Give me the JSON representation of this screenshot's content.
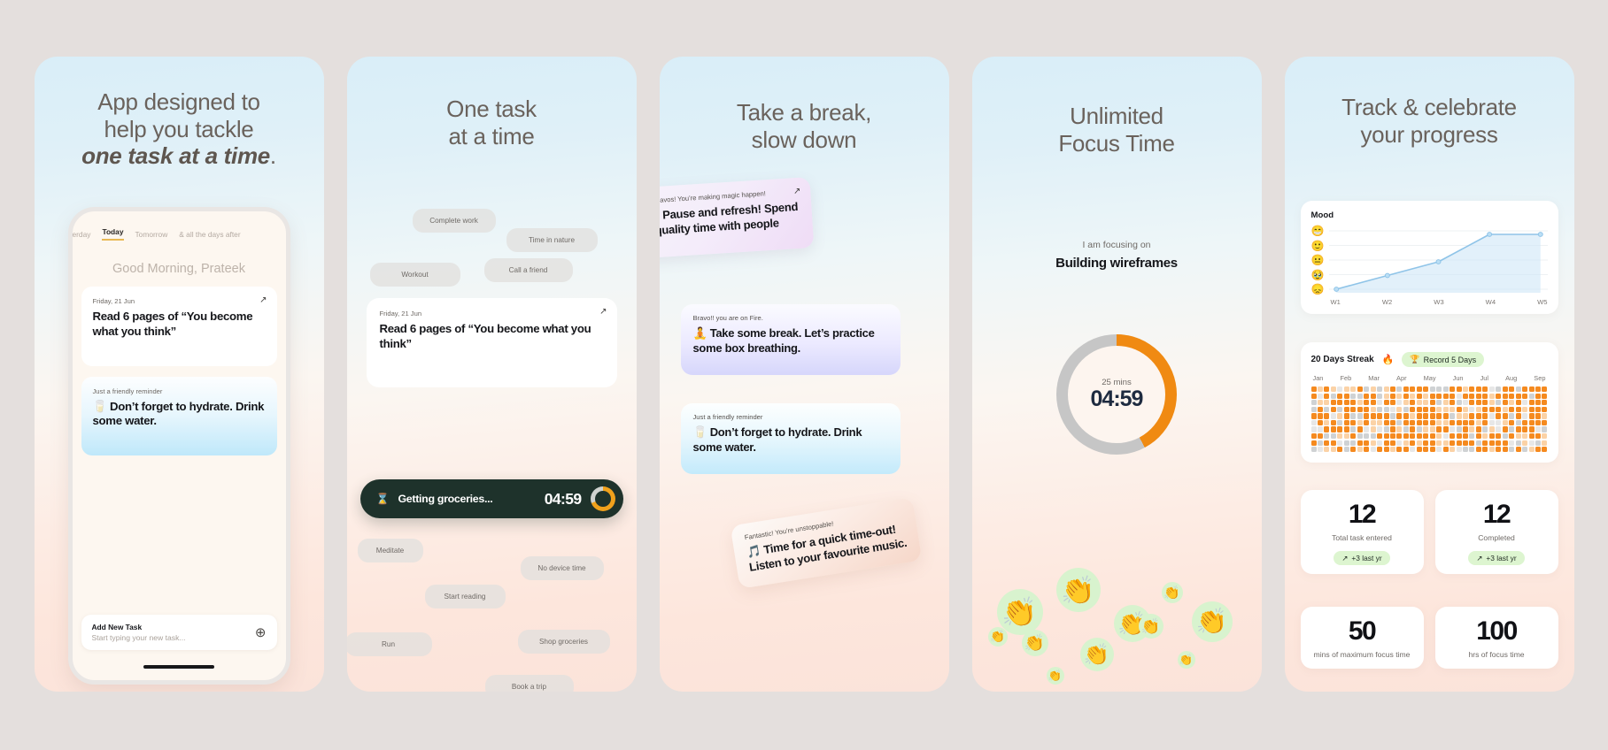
{
  "background_color": "#e4dfdd",
  "accent_orange": "#f08a12",
  "panels": [
    {
      "id": "panel-tasks",
      "headline_line1": "App designed to",
      "headline_line2": "help you tackle",
      "headline_emphasis": "one task at a time",
      "headline_period": ".",
      "phone": {
        "tabs": [
          {
            "label": "Yesterday",
            "active": false
          },
          {
            "label": "Today",
            "active": true
          },
          {
            "label": "Tomorrow",
            "active": false
          },
          {
            "label": "& all the days after",
            "active": false
          }
        ],
        "greeting": "Good Morning, Prateek",
        "cards": [
          {
            "meta": "Friday, 21 Jun",
            "title": "Read 6 pages of “You become what you think”",
            "expand_icon": "↗"
          },
          {
            "meta": "Just a friendly reminder",
            "title": "🥛 Don’t forget to hydrate. Drink some water."
          }
        ],
        "add_task": {
          "label": "Add New Task",
          "placeholder": "Start typing your new task...",
          "plus_icon": "⊕"
        }
      }
    },
    {
      "id": "panel-one-task",
      "headline_line1": "One task",
      "headline_line2": "at a time",
      "chips_top": [
        "Complete work",
        "Time in nature",
        "Workout",
        "Call a friend"
      ],
      "card": {
        "meta": "Friday, 21 Jun",
        "title": "Read 6 pages of “You become what you think”",
        "expand_icon": "↗"
      },
      "timer_pill": {
        "icon": "⌛",
        "label": "Getting groceries...",
        "time": "04:59"
      },
      "chips_bottom": [
        "Meditate",
        "No device time",
        "Start reading",
        "Run",
        "Shop groceries",
        "Book a trip"
      ]
    },
    {
      "id": "panel-break",
      "headline_line1": "Take a break,",
      "headline_line2": "slow down",
      "notes": [
        {
          "meta": "Bravos! You’re making magic happen!",
          "body": "⏸ Pause and refresh! Spend quality time with people",
          "expand_icon": "↗"
        },
        {
          "meta": "Bravo!! you are on Fire.",
          "body": "🧘 Take some break. Let’s practice some box breathing."
        },
        {
          "meta": "Just a friendly reminder",
          "body": "🥛 Don’t forget to hydrate. Drink some water."
        },
        {
          "meta": "Fantastic! You’re unstoppable!",
          "body": "🎵 Time for a quick time-out! Listen to your favourite music."
        }
      ]
    },
    {
      "id": "panel-focus",
      "headline_line1": "Unlimited",
      "headline_line2": "Focus Time",
      "focus_caption": "I am focusing on",
      "focus_task": "Building wireframes",
      "ring": {
        "duration_label": "25 mins",
        "remaining": "04:59",
        "progress_percent": 42
      },
      "clap_emoji": "👏"
    },
    {
      "id": "panel-progress",
      "headline_line1": "Track & celebrate",
      "headline_line2": "your progress",
      "mood_card_title": "Mood",
      "streak": {
        "title": "20 Days Streak",
        "fire_icon": "🔥",
        "badge_icon": "🏆",
        "badge_label": "Record 5 Days",
        "months": [
          "Jan",
          "Feb",
          "Mar",
          "Apr",
          "May",
          "Jun",
          "Jul",
          "Aug",
          "Sep"
        ]
      },
      "stats": [
        {
          "value": "12",
          "label": "Total task entered",
          "delta": "+3 last yr",
          "delta_icon": "↗"
        },
        {
          "value": "12",
          "label": "Completed",
          "delta": "+3 last yr",
          "delta_icon": "↗"
        },
        {
          "value": "50",
          "label": "mins of maximum focus time"
        },
        {
          "value": "100",
          "label": "hrs of focus time"
        }
      ]
    }
  ],
  "chart_data": [
    {
      "type": "line",
      "title": "Mood",
      "x": [
        "W1",
        "W2",
        "W3",
        "W4",
        "W5"
      ],
      "categories": [
        "W1",
        "W2",
        "W3",
        "W4",
        "W5"
      ],
      "values": [
        1,
        2,
        3,
        5,
        5
      ],
      "ytick_labels": [
        "😁",
        "🙂",
        "😐",
        "🥹",
        "😞"
      ],
      "ylim": [
        1,
        5
      ],
      "xlabel": "",
      "ylabel": "Mood",
      "grid": true,
      "legend": "none",
      "line_color": "#8fc4e8",
      "fill_color": "#cfe6f7",
      "area": true
    },
    {
      "type": "heatmap",
      "title": "20 Days Streak",
      "categories": [
        "Jan",
        "Feb",
        "Mar",
        "Apr",
        "May",
        "Jun",
        "Jul",
        "Aug",
        "Sep"
      ],
      "rows": 10,
      "columns": 36,
      "colors": [
        "#f58a1f",
        "#fbd2a6",
        "#cfd2d4",
        "#e7e7e7"
      ],
      "legend": "none"
    }
  ]
}
